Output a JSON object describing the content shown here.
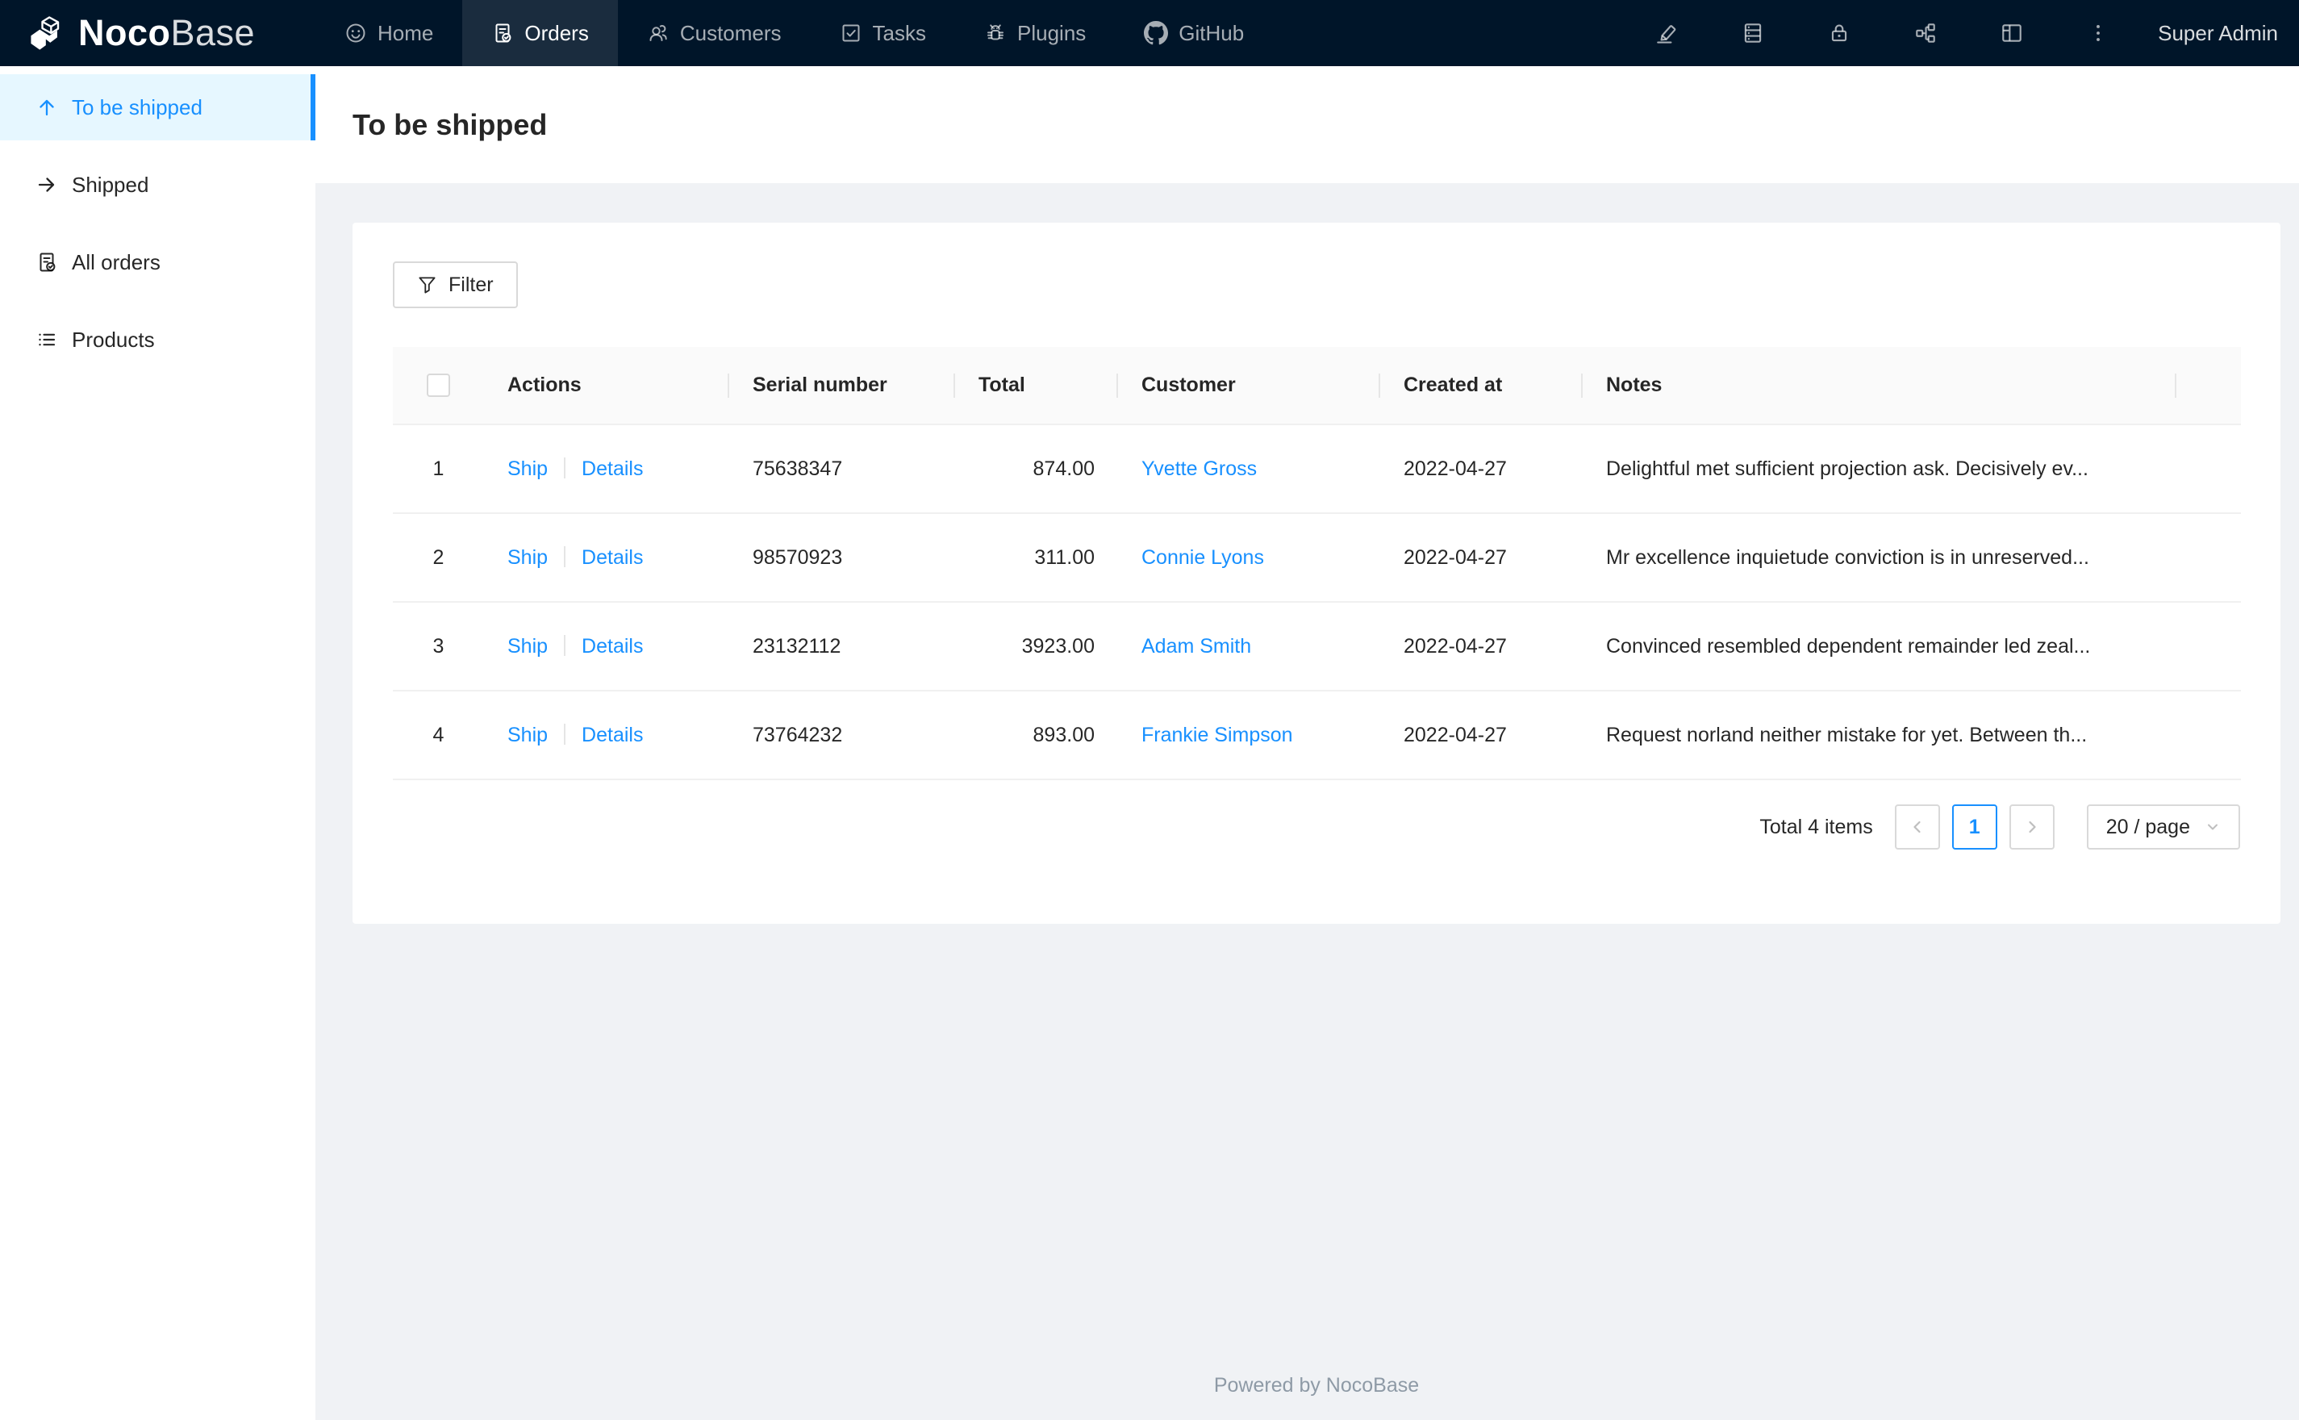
{
  "navbar": {
    "logo": {
      "bold": "Noco",
      "light": "Base",
      "icon": "nocobase-cube-icon"
    },
    "items": [
      {
        "label": "Home",
        "icon": "smile-icon",
        "active": false
      },
      {
        "label": "Orders",
        "icon": "file-done-icon",
        "active": true
      },
      {
        "label": "Customers",
        "icon": "team-icon",
        "active": false
      },
      {
        "label": "Tasks",
        "icon": "check-square-icon",
        "active": false
      },
      {
        "label": "Plugins",
        "icon": "bug-icon",
        "active": false
      },
      {
        "label": "GitHub",
        "icon": "github-icon",
        "active": false
      }
    ],
    "right_icons": [
      "highlight-icon",
      "database-icon",
      "lock-icon",
      "partition-icon",
      "layout-icon",
      "more-icon"
    ],
    "user": "Super Admin"
  },
  "sidebar": {
    "items": [
      {
        "label": "To be shipped",
        "icon": "arrow-up-icon",
        "active": true
      },
      {
        "label": "Shipped",
        "icon": "arrow-right-icon",
        "active": false
      },
      {
        "label": "All orders",
        "icon": "file-done-icon",
        "active": false
      },
      {
        "label": "Products",
        "icon": "list-icon",
        "active": false
      }
    ]
  },
  "page": {
    "title": "To be shipped"
  },
  "toolbar": {
    "filter_label": "Filter"
  },
  "table": {
    "columns": [
      "Actions",
      "Serial number",
      "Total",
      "Customer",
      "Created at",
      "Notes"
    ],
    "action_labels": [
      "Ship",
      "Details"
    ],
    "rows": [
      {
        "index": "1",
        "serial": "75638347",
        "total": "874.00",
        "customer": "Yvette Gross",
        "created_at": "2022-04-27",
        "notes": "Delightful met sufficient projection ask. Decisively ev..."
      },
      {
        "index": "2",
        "serial": "98570923",
        "total": "311.00",
        "customer": "Connie Lyons",
        "created_at": "2022-04-27",
        "notes": "Mr excellence inquietude conviction is in unreserved..."
      },
      {
        "index": "3",
        "serial": "23132112",
        "total": "3923.00",
        "customer": "Adam Smith",
        "created_at": "2022-04-27",
        "notes": "Convinced resembled dependent remainder led zeal..."
      },
      {
        "index": "4",
        "serial": "73764232",
        "total": "893.00",
        "customer": "Frankie Simpson",
        "created_at": "2022-04-27",
        "notes": "Request norland neither mistake for yet. Between th..."
      }
    ]
  },
  "pagination": {
    "total_text": "Total 4 items",
    "prev": "‹",
    "next": "›",
    "page": "1",
    "page_size": "20 / page"
  },
  "footer": {
    "text": "Powered by NocoBase"
  },
  "colors": {
    "accent": "#1890ff",
    "navbar_bg": "#001529",
    "sidebar_active_bg": "#e6f7ff",
    "table_header_bg": "#fafafa",
    "border": "#f0f0f0",
    "page_bg": "#f0f2f5"
  }
}
